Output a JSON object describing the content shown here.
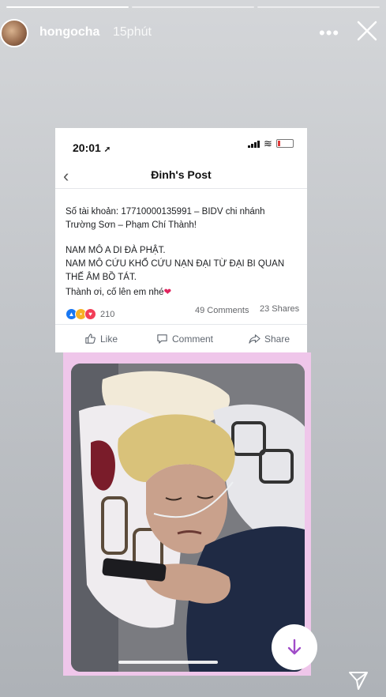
{
  "story": {
    "username": "hongocha",
    "time": "15phút",
    "progress_segments": 3,
    "progress_active": 1,
    "more_icon": "more-icon",
    "close_icon": "close-icon",
    "send_icon": "send-icon"
  },
  "phone": {
    "clock": "20:01",
    "location_arrow": "➚",
    "nav_title": "Đinh's Post",
    "back_icon": "‹"
  },
  "post": {
    "line1": "Số tài khoản: 17710000135991 – BIDV chi nhánh",
    "line2": "Trường Sơn – Phạm Chí Thành!",
    "line3": "NAM MÔ A DI ĐÀ PHẬT.",
    "line4": "NAM MÔ CỨU KHỔ CỨU NẠN ĐẠI TỪ ĐẠI BI QUAN",
    "line5": "THẾ ÂM BỒ TÁT.",
    "line6": "Thành ơi, cố lên em nhé",
    "heart": "❤",
    "reaction_count": "210",
    "comments": "49 Comments",
    "shares": "23 Shares"
  },
  "actions": {
    "like": "Like",
    "comment": "Comment",
    "share": "Share"
  },
  "colors": {
    "fb_blue": "#1877f2",
    "frame_pink": "#efc6ea",
    "swipe_arrow": "#a04cc8"
  }
}
